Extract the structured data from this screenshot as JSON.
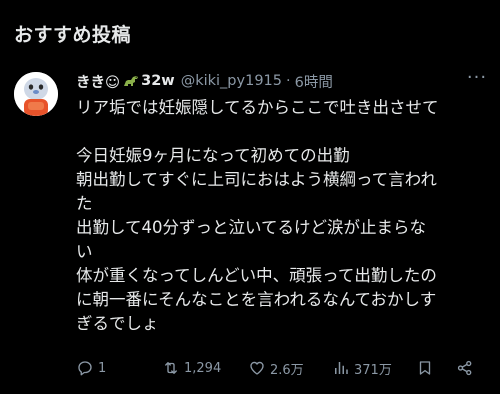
{
  "section": {
    "title": "おすすめ投稿"
  },
  "post": {
    "display_name": "きき☺",
    "name_suffix": "32w",
    "handle": "@kiki_py1915",
    "separator": "·",
    "time": "6時間",
    "more_label": "···",
    "lines": [
      "リア垢では妊娠隠してるからここで吐き出させて",
      "",
      "今日妊娠9ヶ月になって初めての出勤",
      "朝出勤してすぐに上司におはよう横綱って言われ",
      "た",
      "出勤して40分ずっと泣いてるけど涙が止まらな",
      "い",
      "体が重くなってしんどい中、頑張って出勤したの",
      "に朝一番にそんなことを言われるなんておかしす",
      "ぎるでしょ"
    ],
    "actions": {
      "reply_count": "1",
      "repost_count": "1,294",
      "like_count": "2.6万",
      "views_count": "371万"
    }
  },
  "colors": {
    "background": "#000000",
    "text": "#e7e9ea",
    "muted": "#8b98a5",
    "dino": "#8ab04a"
  }
}
